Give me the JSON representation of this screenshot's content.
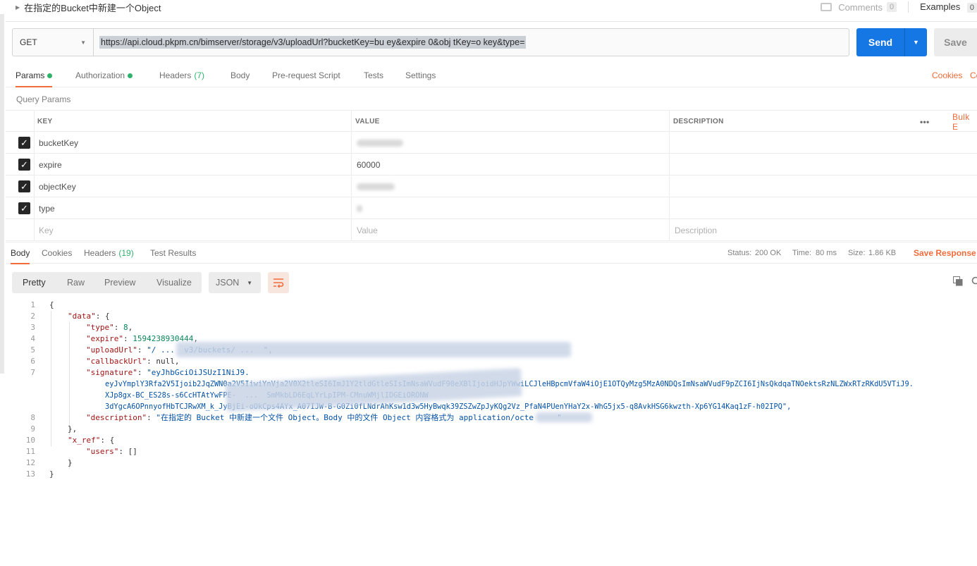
{
  "title_bar": {
    "request_name": "在指定的Bucket中新建一个Object",
    "comments_label": "Comments",
    "comments_count": "0",
    "examples_label": "Examples",
    "examples_count": "0"
  },
  "request": {
    "method": "GET",
    "url": "https://api.cloud.pkpm.cn/bimserver/storage/v3/uploadUrl?bucketKey=bu      ey&expire    0&obj   tKey=o     key&type=",
    "send_label": "Send",
    "save_label": "Save"
  },
  "request_tabs": {
    "params": "Params",
    "authorization": "Authorization",
    "headers": "Headers",
    "headers_count": "(7)",
    "body": "Body",
    "prerequest": "Pre-request Script",
    "tests": "Tests",
    "settings": "Settings",
    "cookies": "Cookies",
    "code": "Co"
  },
  "query_params": {
    "label": "Query Params",
    "columns": {
      "key": "KEY",
      "value": "VALUE",
      "description": "DESCRIPTION",
      "more": "•••",
      "bulk": "Bulk E"
    },
    "rows": [
      {
        "key": "bucketKey",
        "value": ""
      },
      {
        "key": "expire",
        "value": "60000"
      },
      {
        "key": "objectKey",
        "value": ""
      },
      {
        "key": "type",
        "value": ""
      }
    ],
    "placeholder": {
      "key": "Key",
      "value": "Value",
      "description": "Description"
    }
  },
  "response_tabs": {
    "body": "Body",
    "cookies": "Cookies",
    "headers": "Headers",
    "headers_count": "(19)",
    "test_results": "Test Results",
    "status_label": "Status:",
    "status_value": "200 OK",
    "time_label": "Time:",
    "time_value": "80 ms",
    "size_label": "Size:",
    "size_value": "1.86 KB",
    "save_response": "Save Response"
  },
  "response_toolbar": {
    "views": [
      "Pretty",
      "Raw",
      "Preview",
      "Visualize"
    ],
    "format": "JSON"
  },
  "response_body": {
    "line_numbers": [
      "1",
      "2",
      "3",
      "4",
      "5",
      "6",
      "7",
      "",
      "",
      "",
      "8",
      "9",
      "10",
      "11",
      "12",
      "13"
    ],
    "l1": "{",
    "l2_key": "\"data\"",
    "l2_rest": ": {",
    "l3_key": "\"type\"",
    "l3_val": "8",
    "l4_key": "\"expire\"",
    "l4_val": "1594238930444",
    "l5_key": "\"uploadUrl\"",
    "l5_val": "\"/ ...  v3/buckets/ ...  \"",
    "l6_key": "\"callbackUrl\"",
    "l6_val": "null",
    "l7_key": "\"signature\"",
    "l7_val": "\"eyJhbGciOiJSUzI1NiJ9.",
    "l7b": "eyJvYmplY3Rfa2V5Ijoib2JqZWN0a2V5IiwiYnVja2V0X2tleSI6ImJ1Y2tldGtleSIsImNsaWVudF90eXBlIjoidHJpYWwiLCJleHBpcmVfaW4iOjE1OTQyMzg5MzA0NDQsImNsaWVudF9pZCI6IjNsQkdqaTNOektsRzNLZWxRTzRKdU5VTiJ9.",
    "l7c": "XJp8gx-BC_ES28s-s6CcHTAtYwFPE-  ...  SmMkbLD6EqLYrLpIPM-CMnuWMjlIDGEiORONW",
    "l7d": "3dYgcA6OPnnyofHbTCJRwXM_k_JyBjEi-oOkCps4AYx_A07IJW-B-G0Zi0fLNdrAhKsw1d3w5HyBwqk39ZSZwZpJyKQg2Vz_PfaN4PUenYHaY2x-WhG5jx5-q8AvkHSG6kwzth-Xp6YG14Kaq1zF-h02IPQ\",",
    "l8_key": "\"description\"",
    "l8_val": "\"在指定的 Bucket 中新建一个文件 Object。Body 中的文件 Object 内容格式为 application/octe     \"",
    "l9": "},",
    "l10_key": "\"x_ref\"",
    "l10_rest": ": {",
    "l11_key": "\"users\"",
    "l11_rest": ": []",
    "l12": "}",
    "l13": "}"
  }
}
